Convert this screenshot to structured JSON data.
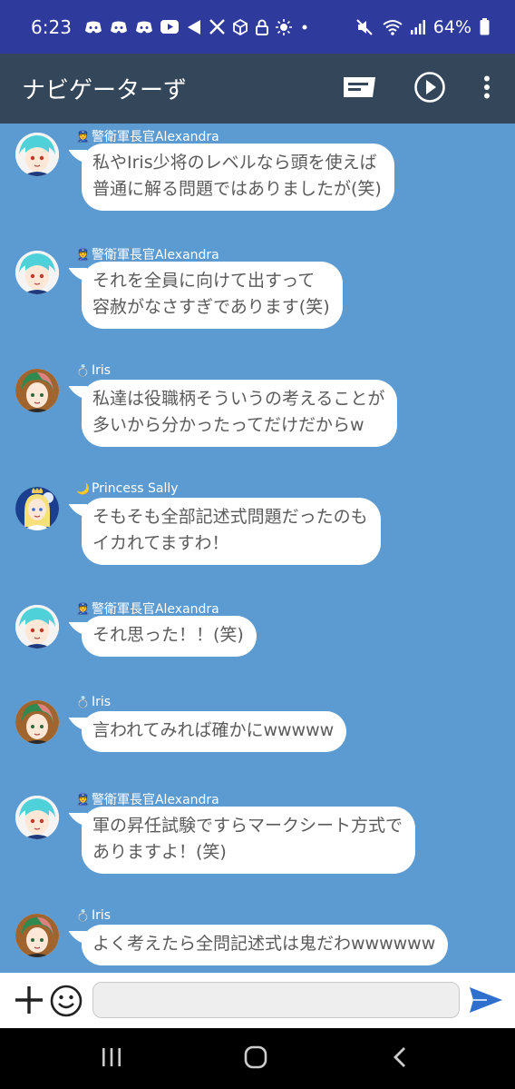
{
  "status_bar": {
    "time": "6:23",
    "battery": "64%",
    "left_icons": [
      "discord-icon",
      "discord-icon",
      "discord-icon",
      "youtube-icon",
      "share-icon",
      "x-icon",
      "cube-icon",
      "lock-icon",
      "brightness-icon",
      "dot-icon"
    ],
    "right_icons": [
      "mute-icon",
      "wifi-icon",
      "signal-icon",
      "battery-icon"
    ]
  },
  "app_bar": {
    "title": "ナビゲーターず",
    "icons": [
      "message-icon",
      "play-icon",
      "more-icon"
    ]
  },
  "messages": [
    {
      "sender": "警衛軍長官Alexandra",
      "sender_icon": "👮",
      "avatar": "alexandra",
      "lines": [
        "私やIris少将のレベルなら頭を使えば",
        "普通に解る問題ではありましたが(笑)"
      ]
    },
    {
      "sender": "警衛軍長官Alexandra",
      "sender_icon": "👮",
      "avatar": "alexandra",
      "lines": [
        "それを全員に向けて出すって",
        "容赦がなさすぎであります(笑)"
      ]
    },
    {
      "sender": "Iris",
      "sender_icon": "💍",
      "avatar": "iris",
      "lines": [
        "私達は役職柄そういうの考えることが",
        "多いから分かったってだけだからw"
      ]
    },
    {
      "sender": "Princess Sally",
      "sender_icon": "🌙",
      "avatar": "sally",
      "lines": [
        "そもそも全部記述式問題だったのも",
        "イカれてますわ！"
      ]
    },
    {
      "sender": "警衛軍長官Alexandra",
      "sender_icon": "👮",
      "avatar": "alexandra",
      "lines": [
        "それ思った！！(笑)"
      ]
    },
    {
      "sender": "Iris",
      "sender_icon": "💍",
      "avatar": "iris",
      "lines": [
        "言われてみれば確かにwwwww"
      ]
    },
    {
      "sender": "警衛軍長官Alexandra",
      "sender_icon": "👮",
      "avatar": "alexandra",
      "lines": [
        "軍の昇任試験ですらマークシート方式で",
        "ありますよ！(笑)"
      ]
    },
    {
      "sender": "Iris",
      "sender_icon": "💍",
      "avatar": "iris",
      "lines": [
        "よく考えたら全問記述式は鬼だわwwwwww"
      ]
    }
  ],
  "input_bar": {
    "placeholder": "",
    "value": "",
    "icons": [
      "plus-icon",
      "emoji-icon",
      "send-icon"
    ]
  },
  "nav_bar": {
    "icons": [
      "recents-icon",
      "home-icon",
      "back-icon"
    ]
  }
}
